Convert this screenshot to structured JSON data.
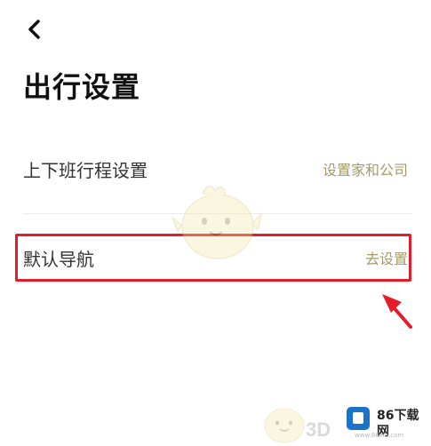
{
  "header": {
    "back_icon": "chevron-left-icon",
    "title": "出行设置"
  },
  "settings": [
    {
      "label": "上下班行程设置",
      "action": "设置家和公司"
    },
    {
      "label": "默认导航",
      "action": "去设置",
      "highlighted": true
    }
  ],
  "colors": {
    "action_text": "#a39b6a",
    "highlight": "#e31d2a",
    "divider": "#ececec",
    "title": "#111111"
  },
  "watermark": {
    "mascot_icon": "chick-mascot-icon",
    "partial_text": "3D",
    "logo_icon": "download-site-logo-icon",
    "brand": "86下载网",
    "url": "www.86xia.com"
  }
}
